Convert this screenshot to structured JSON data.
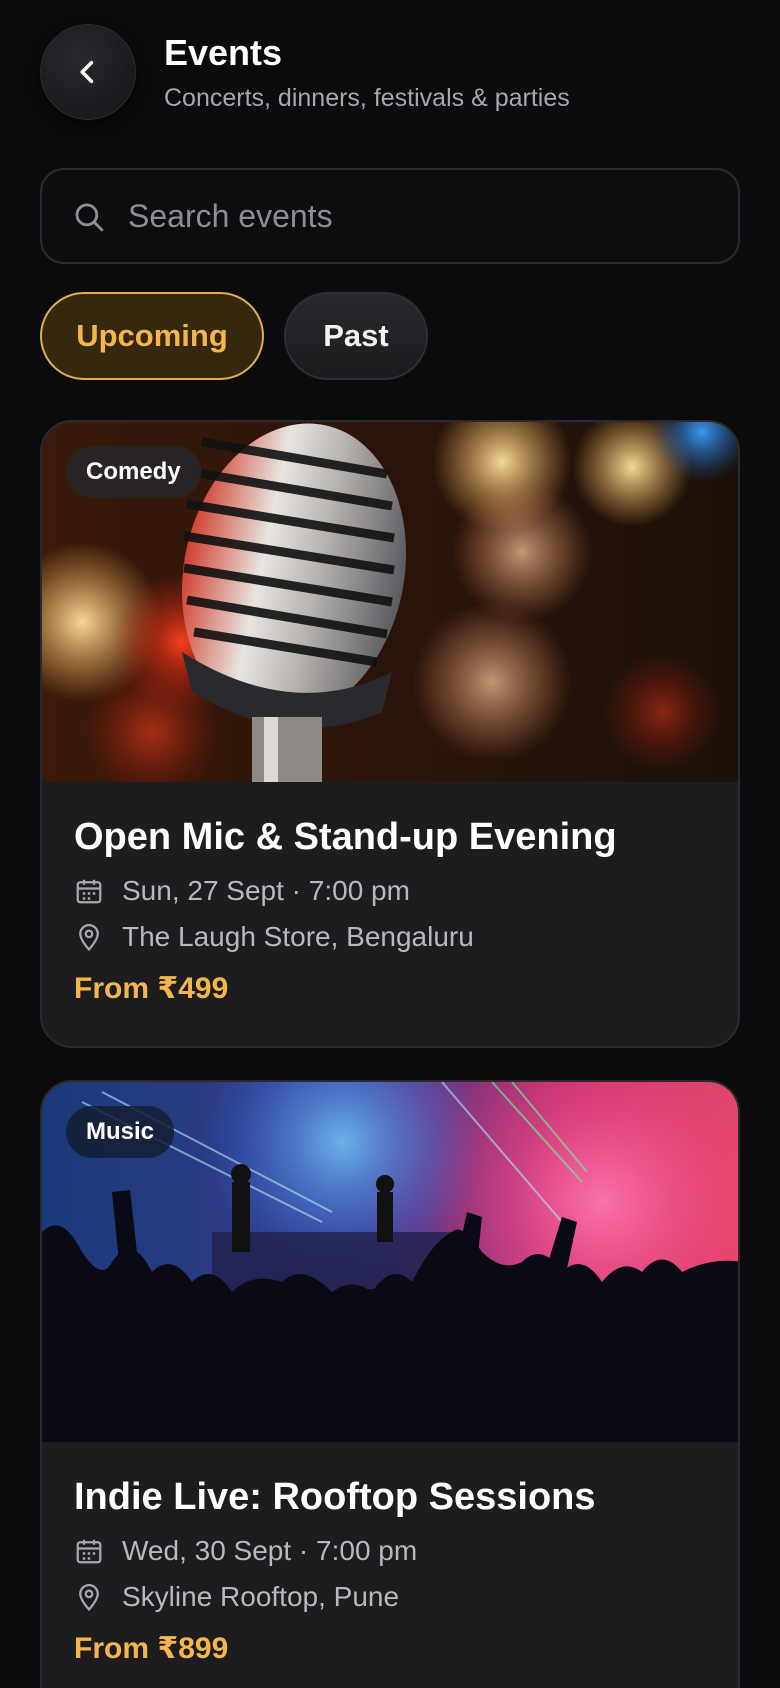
{
  "header": {
    "title": "Events",
    "subtitle": "Concerts, dinners, festivals & parties",
    "back_icon": "chevron-left-icon"
  },
  "search": {
    "placeholder": "Search events",
    "value": "",
    "icon": "search-icon"
  },
  "tabs": [
    {
      "label": "Upcoming",
      "selected": true
    },
    {
      "label": "Past",
      "selected": false
    }
  ],
  "colors": {
    "background": "#0b0b0d",
    "card": "#1d1d20",
    "accent": "#f4b64c",
    "muted_text": "#b8b8be"
  },
  "events": [
    {
      "category": "Comedy",
      "title": "Open Mic & Stand-up Evening",
      "date": "Sun, 27 Sept · 7:00 pm",
      "venue": "The Laugh Store, Bengaluru",
      "price": "From ₹499",
      "image": "microphone-stage-photo"
    },
    {
      "category": "Music",
      "title": "Indie Live: Rooftop Sessions",
      "date": "Wed, 30 Sept · 7:00 pm",
      "venue": "Skyline Rooftop, Pune",
      "price": "From ₹899",
      "image": "concert-crowd-photo"
    }
  ]
}
